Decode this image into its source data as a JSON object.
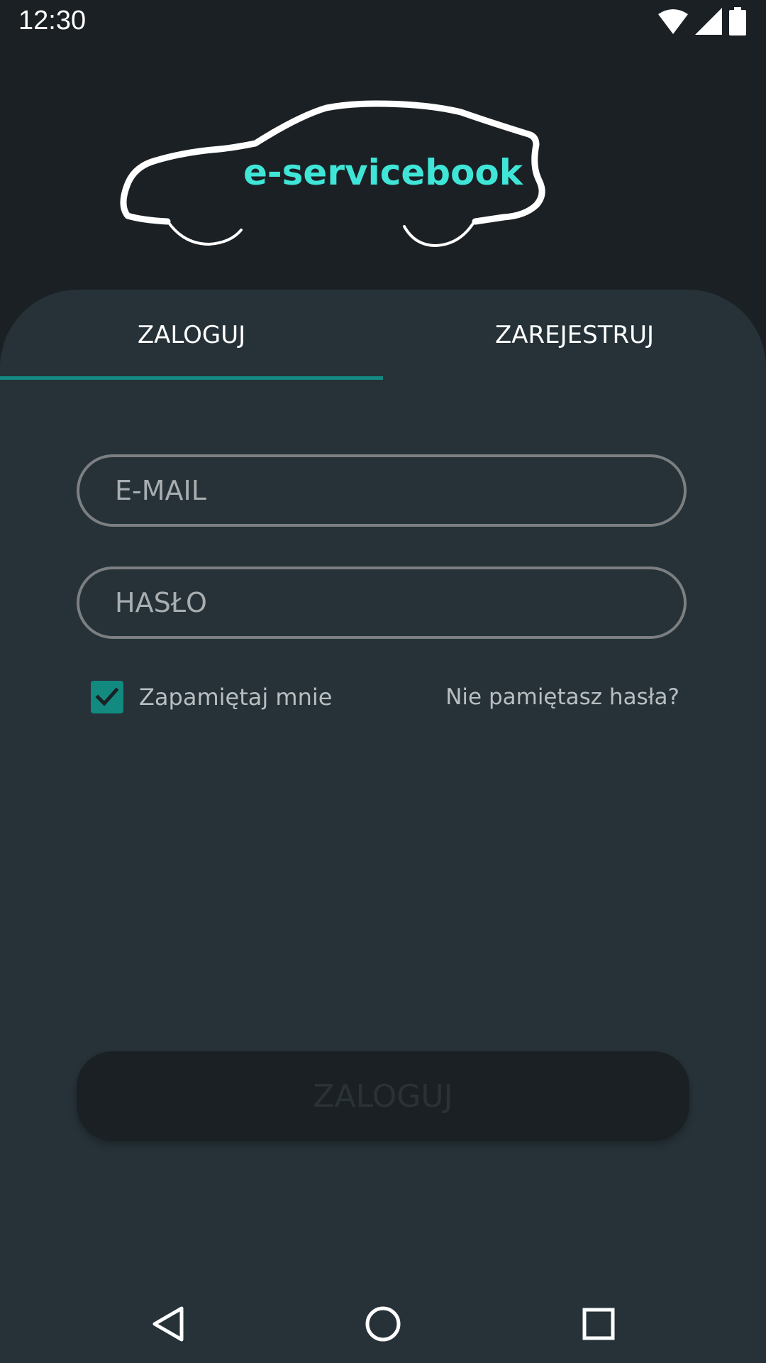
{
  "status_bar": {
    "time": "12:30",
    "icons": [
      "wifi-icon",
      "signal-icon",
      "battery-icon"
    ]
  },
  "logo": {
    "text": "e-servicebook",
    "icon": "car-outline-icon",
    "text_color": "#3fe6d8"
  },
  "tabs": [
    {
      "label": "ZALOGUJ",
      "active": true
    },
    {
      "label": "ZAREJESTRUJ",
      "active": false
    }
  ],
  "form": {
    "email_placeholder": "E-MAIL",
    "password_placeholder": "HASŁO",
    "remember_label": "Zapamiętaj mnie",
    "remember_checked": true,
    "forgot_label": "Nie pamiętasz hasła?",
    "submit_label": "ZALOGUJ"
  },
  "nav_bar": {
    "icons": [
      "back-icon",
      "home-icon",
      "recents-icon"
    ]
  },
  "colors": {
    "accent": "#138b83",
    "header_bg": "#1b2024",
    "panel_bg": "#263238"
  }
}
